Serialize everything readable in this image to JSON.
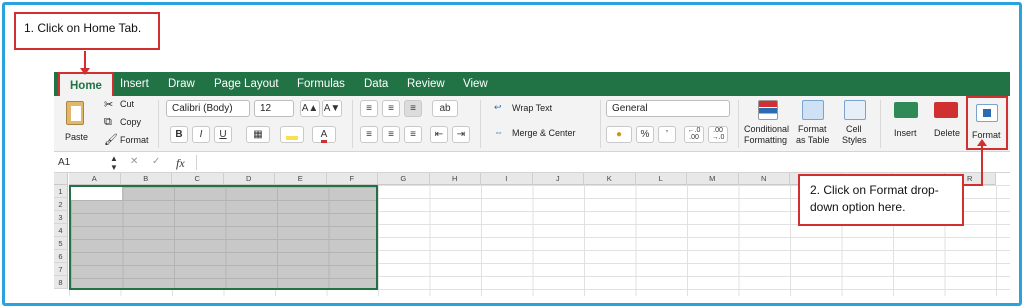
{
  "callouts": {
    "step1": "1. Click on Home Tab.",
    "step2": "2. Click on Format drop-down option here."
  },
  "tabs": [
    "Home",
    "Insert",
    "Draw",
    "Page Layout",
    "Formulas",
    "Data",
    "Review",
    "View"
  ],
  "active_tab": "Home",
  "clipboard": {
    "paste": "Paste",
    "cut": "Cut",
    "copy": "Copy",
    "format": "Format"
  },
  "font": {
    "name": "Calibri (Body)",
    "size": "12",
    "bold": "B",
    "italic": "I",
    "underline": "U",
    "grow": "A▲",
    "shrink": "A▼",
    "color_letter": "A"
  },
  "alignment": {
    "wrap_text": "Wrap Text",
    "merge_center": "Merge & Center"
  },
  "number": {
    "format": "General",
    "percent": "%",
    "comma": "’",
    "inc_decimal": "←.0\n.00",
    "dec_decimal": ".00\n→.0"
  },
  "styles": {
    "conditional": [
      "Conditional",
      "Formatting"
    ],
    "format_table": [
      "Format",
      "as Table"
    ],
    "cell_styles": [
      "Cell",
      "Styles"
    ]
  },
  "cells_group": {
    "insert": "Insert",
    "delete": "Delete",
    "format": "Format"
  },
  "formula_bar": {
    "name_box": "A1",
    "fx": "fx",
    "cancel": "✕",
    "enter": "✓"
  },
  "columns": [
    "A",
    "B",
    "C",
    "D",
    "E",
    "F",
    "G",
    "H",
    "I",
    "J",
    "K",
    "L",
    "M",
    "N",
    "O",
    "P",
    "Q",
    "R"
  ],
  "rows": [
    "1",
    "2",
    "3",
    "4",
    "5",
    "6",
    "7",
    "8"
  ],
  "colors": {
    "excel_green": "#217346",
    "callout_red": "#d0302f",
    "frame_blue": "#29a3dd"
  }
}
